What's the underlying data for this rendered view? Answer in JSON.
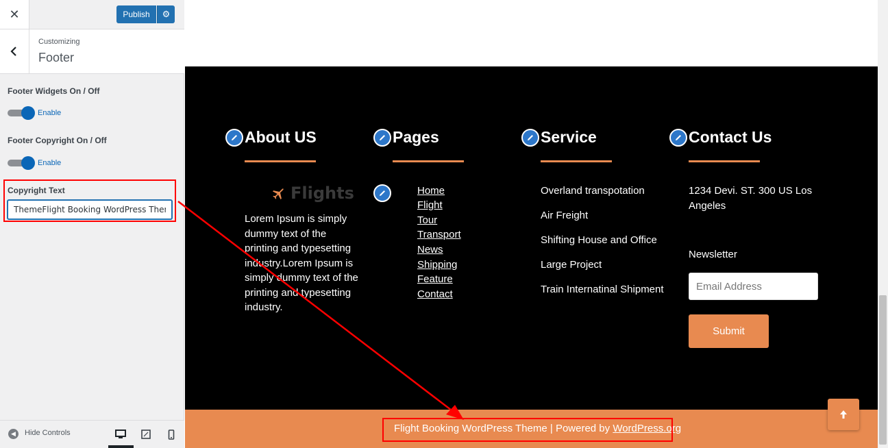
{
  "customizer": {
    "publish_label": "Publish",
    "customizing_label": "Customizing",
    "section_title": "Footer",
    "controls": [
      {
        "title": "Footer Widgets On / Off",
        "toggle_label": "Enable",
        "checked": true
      },
      {
        "title": "Footer Copyright On / Off",
        "toggle_label": "Enable",
        "checked": true
      }
    ],
    "copyright_label": "Copyright Text",
    "copyright_value": "ThemeFlight Booking WordPress Theme",
    "hide_controls_label": "Hide Controls",
    "devices": [
      "desktop-icon",
      "tablet-icon",
      "mobile-icon"
    ]
  },
  "footer": {
    "about": {
      "title": "About US",
      "logo_text": "Flights",
      "description": "Lorem Ipsum is simply dummy text of the printing and typesetting industry.Lorem Ipsum is simply dummy text of the printing and typesetting industry."
    },
    "pages": {
      "title": "Pages",
      "links": [
        "Home",
        "Flight",
        "Tour",
        "Transport",
        "News",
        "Shipping",
        "Feature",
        "Contact"
      ]
    },
    "service": {
      "title": "Service",
      "items": [
        "Overland transpotation",
        "Air Freight",
        "Shifting House and Office",
        "Large Project",
        "Train Internatinal Shipment"
      ]
    },
    "contact": {
      "title": "Contact Us",
      "address": "1234 Devi. ST. 300 US Los Angeles",
      "newsletter_label": "Newsletter",
      "email_placeholder": "Email Address",
      "submit_label": "Submit"
    },
    "copyright": {
      "text": "Flight Booking WordPress Theme | Powered by ",
      "link": "WordPress.org"
    }
  },
  "colors": {
    "accent": "#e88a50",
    "wp_blue": "#2271b1",
    "annotation_red": "#ff0000",
    "edit_icon_blue": "#2d77c9"
  }
}
